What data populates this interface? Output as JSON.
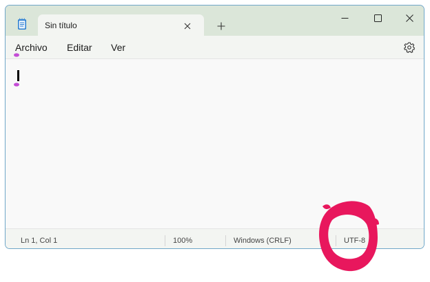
{
  "tab": {
    "title": "Sin título",
    "close_icon": "close-icon",
    "new_tab_icon": "plus-icon"
  },
  "window_controls": {
    "minimize_icon": "minimize-icon",
    "maximize_icon": "maximize-icon",
    "close_icon": "close-icon"
  },
  "menu": {
    "items": [
      "Archivo",
      "Editar",
      "Ver"
    ],
    "settings_icon": "gear-icon"
  },
  "editor": {
    "text": ""
  },
  "status": {
    "position": "Ln 1, Col 1",
    "zoom": "100%",
    "line_ending": "Windows (CRLF)",
    "encoding": "UTF-8"
  },
  "colors": {
    "titlebar": "#dbe6d9",
    "window_border": "#6ea6c8",
    "annotation": "#e8175d",
    "caret_marker": "#c44dd6"
  }
}
